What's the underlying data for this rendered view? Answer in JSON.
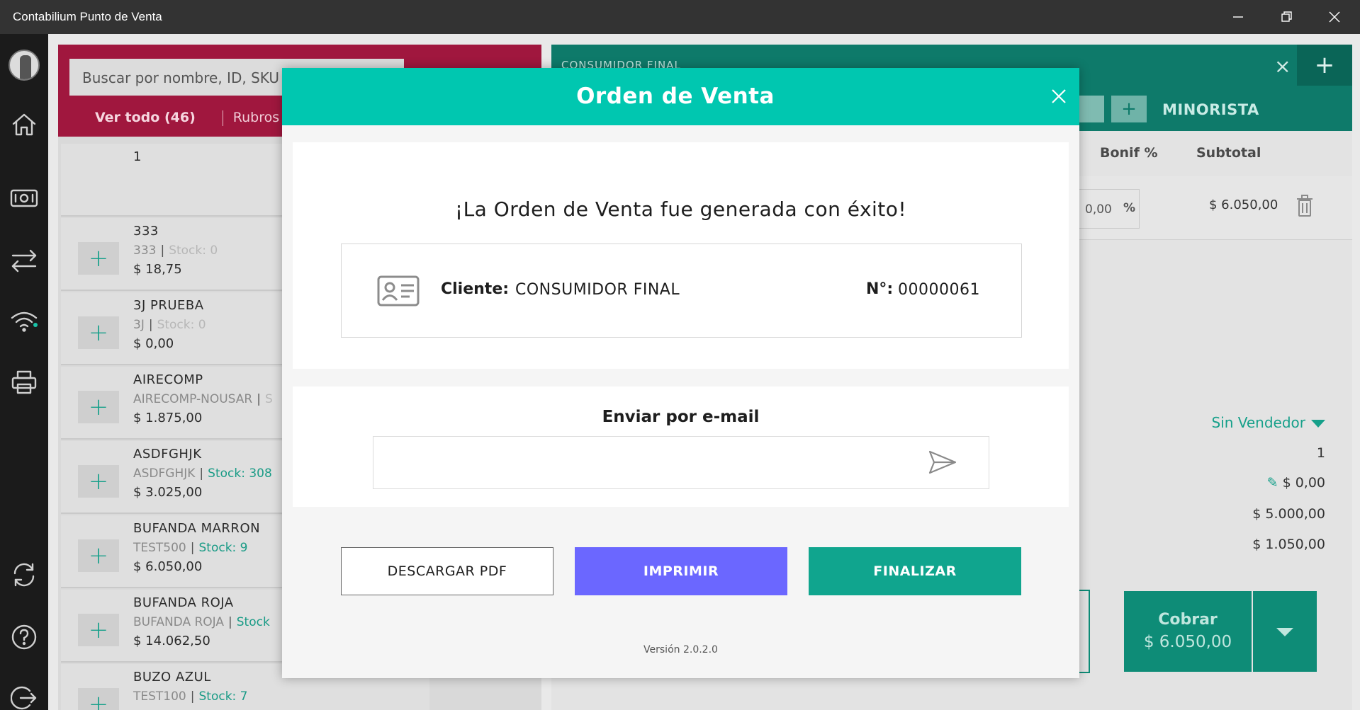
{
  "window": {
    "title": "Contabilium Punto de Venta"
  },
  "products": {
    "search_placeholder": "Buscar por nombre, ID, SKU",
    "filter_all": "Ver todo (46)",
    "filter_categories": "Rubros",
    "items": [
      {
        "name": "1",
        "sku": "",
        "stock": "",
        "price": ""
      },
      {
        "name": "333",
        "sku": "333",
        "stock": "Stock: 0",
        "price": "$ 18,75"
      },
      {
        "name": "3J PRUEBA",
        "sku": "3J",
        "stock": "Stock: 0",
        "price": "$ 0,00"
      },
      {
        "name": "AIRECOMP",
        "sku": "AIRECOMP-NOUSAR",
        "stock": "S",
        "price": "$ 1.875,00"
      },
      {
        "name": "ASDFGHJK",
        "sku": "ASDFGHJK",
        "stock": "Stock: 308",
        "price": "$ 3.025,00"
      },
      {
        "name": "BUFANDA MARRON",
        "sku": "TEST500",
        "stock": "Stock: 9",
        "price": "$ 6.050,00"
      },
      {
        "name": "BUFANDA ROJA",
        "sku": "BUFANDA ROJA",
        "stock": "Stock",
        "price": "$ 14.062,50"
      },
      {
        "name": "BUZO AZUL",
        "sku": "TEST100",
        "stock": "Stock: 7",
        "price": ""
      }
    ]
  },
  "order": {
    "client": "CONSUMIDOR FINAL",
    "price_list": "MINORISTA",
    "columns": {
      "bonif": "Bonif %",
      "subtotal": "Subtotal"
    },
    "line": {
      "bonif_value": "0,00",
      "bonif_unit": "%",
      "subtotal": "$ 6.050,00"
    },
    "summary": {
      "seller": "Sin Vendedor",
      "qty": "1",
      "discount": "$ 0,00",
      "net": "$ 5.000,00",
      "tax": "$ 1.050,00"
    },
    "charge": {
      "label": "Cobrar",
      "amount": "$ 6.050,00"
    }
  },
  "modal": {
    "title": "Orden de Venta",
    "success_message": "¡La Orden de Venta fue generada con éxito!",
    "client_label": "Cliente:",
    "client_value": "CONSUMIDOR FINAL",
    "number_label": "N°:",
    "number_value": "00000061",
    "email_label": "Enviar por e-mail",
    "email_value": "",
    "btn_pdf": "DESCARGAR PDF",
    "btn_print": "IMPRIMIR",
    "btn_finish": "FINALIZAR",
    "version": "Versión 2.0.2.0"
  },
  "colors": {
    "modal_header": "#00c7b0",
    "print_button": "#6b67ff",
    "finish_button": "#10a58e",
    "products_header": "#a0173e",
    "order_header": "#0e7a6a"
  }
}
